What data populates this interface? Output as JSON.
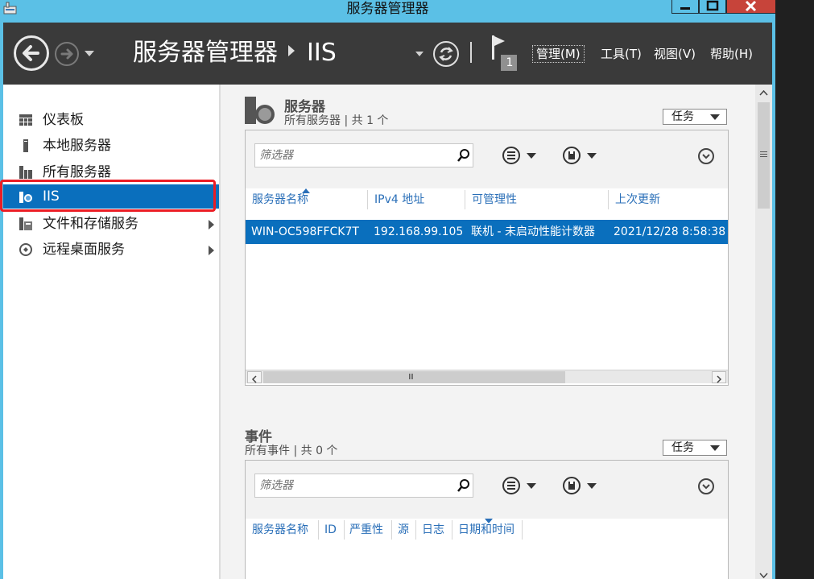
{
  "window": {
    "title": "服务器管理器",
    "accent_color": "#5bc0e6",
    "close_color": "#c7443a"
  },
  "header": {
    "breadcrumb_root": "服务器管理器",
    "breadcrumb_current": "IIS",
    "notification_count": "1",
    "menus": [
      {
        "label": "管理(M)"
      },
      {
        "label": "工具(T)"
      },
      {
        "label": "视图(V)"
      },
      {
        "label": "帮助(H)"
      }
    ]
  },
  "sidebar": {
    "items": [
      {
        "label": "仪表板",
        "icon": "dashboard-icon"
      },
      {
        "label": "本地服务器",
        "icon": "local-server-icon"
      },
      {
        "label": "所有服务器",
        "icon": "all-servers-icon"
      },
      {
        "label": "IIS",
        "icon": "iis-icon",
        "selected": true
      },
      {
        "label": "文件和存储服务",
        "icon": "file-storage-icon",
        "expandable": true
      },
      {
        "label": "远程桌面服务",
        "icon": "remote-desktop-icon",
        "expandable": true
      }
    ],
    "selected_color": "#0a6fbd",
    "highlight_color": "#ec1c24"
  },
  "servers": {
    "title": "服务器",
    "subtitle": "所有服务器 | 共 1 个",
    "tasks_label": "任务",
    "filter_placeholder": "筛选器",
    "scroll_glyph": "III",
    "columns": [
      "服务器名称",
      "IPv4 地址",
      "可管理性",
      "上次更新"
    ],
    "rows": [
      [
        "WIN-OC598FFCK7T",
        "192.168.99.105",
        "联机 - 未启动性能计数器",
        "2021/12/28 8:58:38"
      ]
    ]
  },
  "events": {
    "title": "事件",
    "subtitle": "所有事件 | 共 0 个",
    "tasks_label": "任务",
    "filter_placeholder": "筛选器",
    "columns": [
      "服务器名称",
      "ID",
      "严重性",
      "源",
      "日志",
      "日期和时间"
    ]
  }
}
